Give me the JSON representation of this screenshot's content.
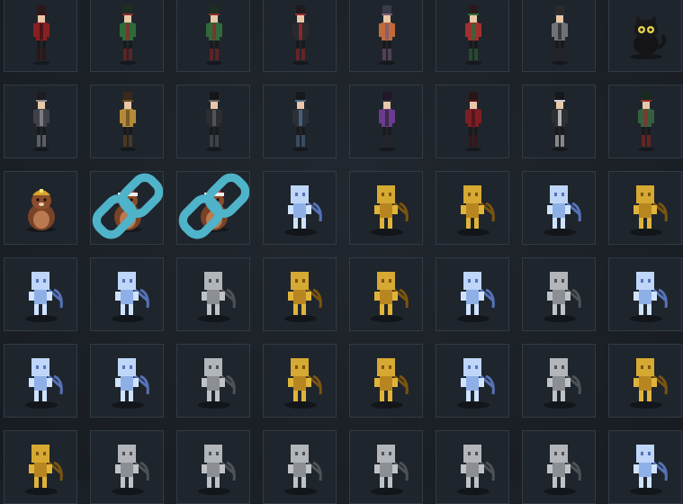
{
  "colors": {
    "slot_bg": "#1f252c",
    "slot_border": "#323a43",
    "link_icon": "#4fb3c9"
  },
  "inventory": {
    "items": [
      {
        "icon": "nutcracker-icon",
        "variant": "red"
      },
      {
        "icon": "nutcracker-icon",
        "variant": "green"
      },
      {
        "icon": "nutcracker-icon",
        "variant": "green"
      },
      {
        "icon": "nutcracker-icon",
        "variant": "black-red"
      },
      {
        "icon": "nutcracker-icon",
        "variant": "orange"
      },
      {
        "icon": "nutcracker-icon",
        "variant": "green-red"
      },
      {
        "icon": "nutcracker-icon",
        "variant": "grey"
      },
      {
        "icon": "black-cat-plush-icon",
        "variant": "black"
      },
      {
        "icon": "nutcracker-icon",
        "variant": "black-grey"
      },
      {
        "icon": "nutcracker-icon",
        "variant": "gold"
      },
      {
        "icon": "nutcracker-icon",
        "variant": "black"
      },
      {
        "icon": "nutcracker-icon",
        "variant": "black-blue"
      },
      {
        "icon": "nutcracker-icon",
        "variant": "purple"
      },
      {
        "icon": "nutcracker-icon",
        "variant": "dark-red"
      },
      {
        "icon": "nutcracker-icon",
        "variant": "black-white"
      },
      {
        "icon": "nutcracker-icon",
        "variant": "green-black"
      },
      {
        "icon": "groundhog-plush-icon",
        "variant": "miner-hat",
        "linked": false
      },
      {
        "icon": "groundhog-plush-icon",
        "variant": "santa-hat",
        "linked": true
      },
      {
        "icon": "groundhog-plush-icon",
        "variant": "santa-hat",
        "linked": true
      },
      {
        "icon": "miner-robot-icon",
        "variant": "ice"
      },
      {
        "icon": "miner-robot-icon",
        "variant": "gold"
      },
      {
        "icon": "miner-robot-icon",
        "variant": "gold"
      },
      {
        "icon": "miner-robot-icon",
        "variant": "ice"
      },
      {
        "icon": "miner-robot-icon",
        "variant": "gold"
      },
      {
        "icon": "miner-robot-icon",
        "variant": "ice"
      },
      {
        "icon": "miner-robot-icon",
        "variant": "ice"
      },
      {
        "icon": "miner-robot-icon",
        "variant": "silver"
      },
      {
        "icon": "miner-robot-icon",
        "variant": "gold"
      },
      {
        "icon": "miner-robot-icon",
        "variant": "gold"
      },
      {
        "icon": "miner-robot-icon",
        "variant": "ice"
      },
      {
        "icon": "miner-robot-icon",
        "variant": "silver"
      },
      {
        "icon": "miner-robot-icon",
        "variant": "ice"
      },
      {
        "icon": "miner-robot-icon",
        "variant": "ice"
      },
      {
        "icon": "miner-robot-icon",
        "variant": "ice"
      },
      {
        "icon": "miner-robot-icon",
        "variant": "silver"
      },
      {
        "icon": "miner-robot-icon",
        "variant": "gold"
      },
      {
        "icon": "miner-robot-icon",
        "variant": "gold"
      },
      {
        "icon": "miner-robot-icon",
        "variant": "ice"
      },
      {
        "icon": "miner-robot-icon",
        "variant": "silver"
      },
      {
        "icon": "miner-robot-icon",
        "variant": "gold"
      },
      {
        "icon": "miner-robot-icon",
        "variant": "gold"
      },
      {
        "icon": "miner-robot-icon",
        "variant": "silver"
      },
      {
        "icon": "miner-robot-icon",
        "variant": "silver"
      },
      {
        "icon": "miner-robot-icon",
        "variant": "silver"
      },
      {
        "icon": "miner-robot-icon",
        "variant": "silver"
      },
      {
        "icon": "miner-robot-icon",
        "variant": "silver"
      },
      {
        "icon": "miner-robot-icon",
        "variant": "silver"
      },
      {
        "icon": "miner-robot-icon",
        "variant": "ice"
      }
    ]
  }
}
